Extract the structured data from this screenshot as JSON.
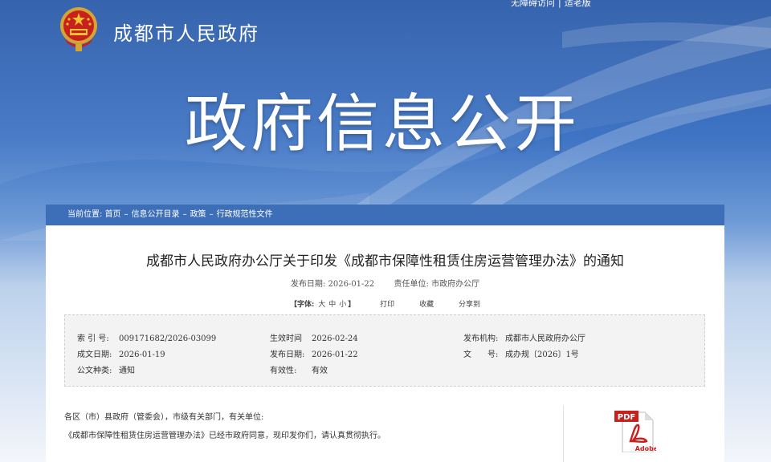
{
  "header": {
    "access_links": [
      "无障碍访问",
      "适老版"
    ],
    "site_name": "成都市人民政府",
    "section_title": "政府信息公开"
  },
  "breadcrumb": {
    "label": "当前位置:",
    "items": [
      "首页",
      "信息公开目录",
      "政策",
      "行政规范性文件"
    ],
    "separator": "–"
  },
  "document": {
    "title": "成都市人民政府办公厅关于印发《成都市保障性租赁住房运营管理办法》的通知",
    "publish_label": "发布日期:",
    "publish_date": "2026-01-22",
    "unit_label": "责任单位:",
    "unit": "市政府办公厅",
    "font_label": "【字体:",
    "font_sizes": [
      "大",
      "中",
      "小"
    ],
    "font_close": "】",
    "print": "打印",
    "favorite": "收藏",
    "share": "分享到"
  },
  "info": {
    "index_no": {
      "k": "索 引 号:",
      "v": "009171682/2026-03099"
    },
    "effective_time": {
      "k": "生效时间",
      "v": "2026-02-24"
    },
    "issuer": {
      "k": "发布机构:",
      "v": "成都市人民政府办公厅"
    },
    "written_date": {
      "k": "成文日期:",
      "v": "2026-01-19"
    },
    "publish_date": {
      "k": "发布日期:",
      "v": "2026-01-22"
    },
    "doc_no": {
      "k": "文　　号:",
      "v": "成办规〔2026〕1号"
    },
    "doc_type": {
      "k": "公文种类:",
      "v": "通知"
    },
    "validity": {
      "k": "有效性:",
      "v": "有效"
    }
  },
  "body": {
    "salutation": "各区（市）县政府（管委会），市级有关部门，有关单位:",
    "paragraph1": "《成都市保障性租赁住房运营管理办法》已经市政府同意，现印发你们，请认真贯彻执行。"
  },
  "attachment": {
    "pdf_badge": "PDF",
    "pdf_brand": "Adobe"
  },
  "colors": {
    "breadcrumb_bg": "#3d6fb8",
    "header_blue": "#2a5aa8"
  }
}
